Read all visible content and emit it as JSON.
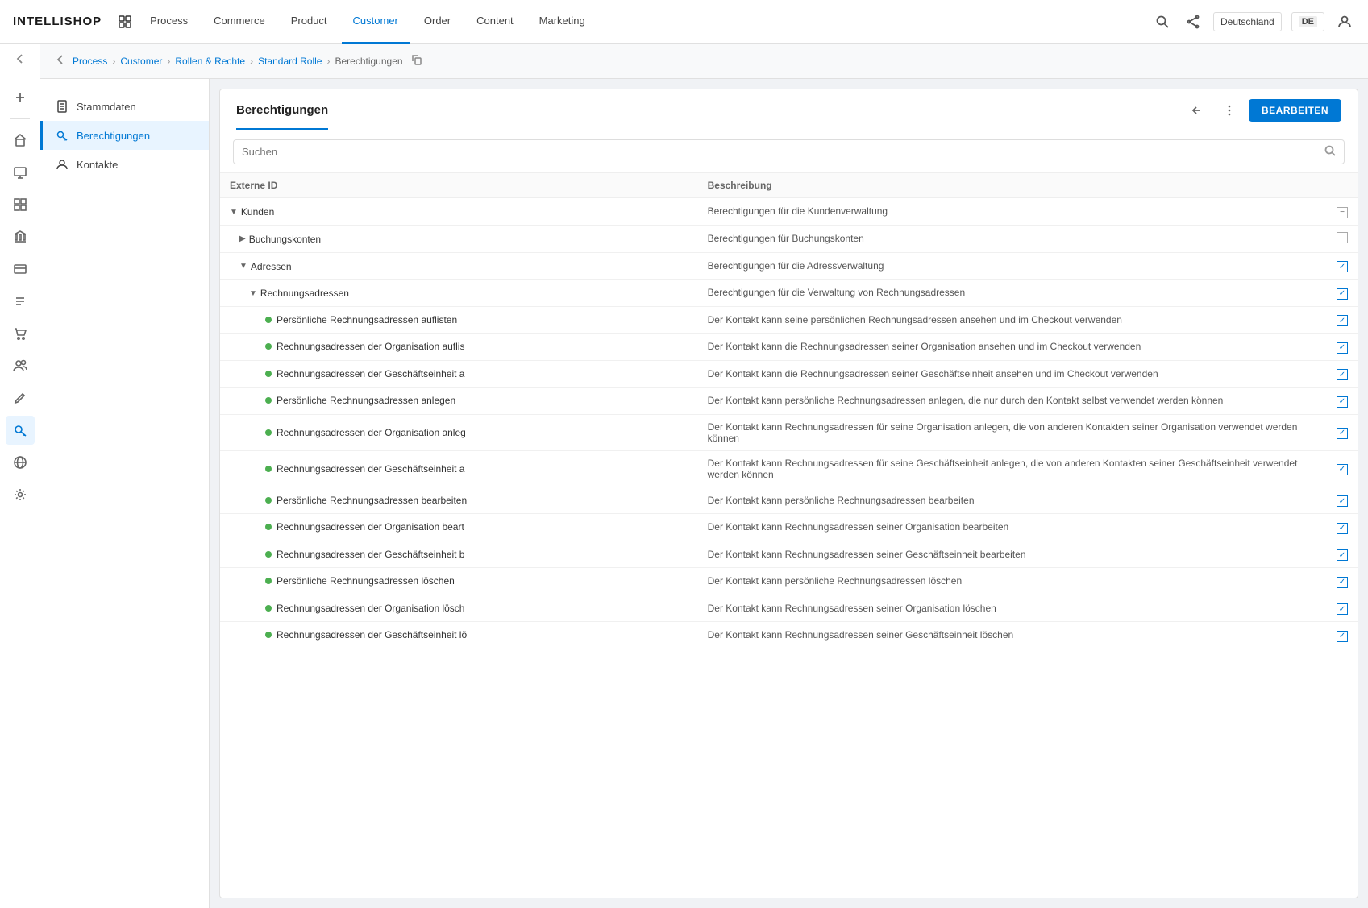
{
  "logo": "INTELLISHOP",
  "nav": {
    "items": [
      {
        "label": "Process",
        "active": false
      },
      {
        "label": "Commerce",
        "active": false
      },
      {
        "label": "Product",
        "active": false
      },
      {
        "label": "Customer",
        "active": true
      },
      {
        "label": "Order",
        "active": false
      },
      {
        "label": "Content",
        "active": false
      },
      {
        "label": "Marketing",
        "active": false
      }
    ],
    "language": "Deutschland",
    "langCode": "DE"
  },
  "breadcrumb": {
    "items": [
      "Process",
      "Customer",
      "Rollen & Rechte",
      "Standard Rolle"
    ],
    "current": "Berechtigungen"
  },
  "sidebarNav": {
    "items": [
      {
        "label": "Stammdaten",
        "icon": "document"
      },
      {
        "label": "Berechtigungen",
        "icon": "key",
        "active": true
      },
      {
        "label": "Kontakte",
        "icon": "contacts"
      }
    ]
  },
  "panel": {
    "title": "Berechtigungen",
    "editLabel": "BEARBEITEN",
    "search": {
      "placeholder": "Suchen"
    },
    "table": {
      "columns": [
        "Externe ID",
        "Beschreibung"
      ],
      "rows": [
        {
          "indent": 0,
          "expand": "down",
          "dot": false,
          "label": "Kunden",
          "desc": "Berechtigungen für die Kundenverwaltung",
          "check": "minus"
        },
        {
          "indent": 1,
          "expand": "right",
          "dot": false,
          "label": "Buchungskonten",
          "desc": "Berechtigungen für Buchungskonten",
          "check": "empty"
        },
        {
          "indent": 1,
          "expand": "down",
          "dot": false,
          "label": "Adressen",
          "desc": "Berechtigungen für die Adressverwaltung",
          "check": "checked"
        },
        {
          "indent": 2,
          "expand": "down",
          "dot": false,
          "label": "Rechnungsadressen",
          "desc": "Berechtigungen für die Verwaltung von Rechnungsadressen",
          "check": "checked"
        },
        {
          "indent": 3,
          "expand": false,
          "dot": true,
          "label": "Persönliche Rechnungsadressen auflisten",
          "desc": "Der Kontakt kann seine persönlichen Rechnungsadressen ansehen und im Checkout verwenden",
          "check": "checked"
        },
        {
          "indent": 3,
          "expand": false,
          "dot": true,
          "label": "Rechnungsadressen der Organisation auflis",
          "desc": "Der Kontakt kann die Rechnungsadressen seiner Organisation ansehen und im Checkout verwenden",
          "check": "checked"
        },
        {
          "indent": 3,
          "expand": false,
          "dot": true,
          "label": "Rechnungsadressen der Geschäftseinheit a",
          "desc": "Der Kontakt kann die Rechnungsadressen seiner Geschäftseinheit ansehen und im Checkout verwenden",
          "check": "checked"
        },
        {
          "indent": 3,
          "expand": false,
          "dot": true,
          "label": "Persönliche Rechnungsadressen anlegen",
          "desc": "Der Kontakt kann persönliche Rechnungsadressen anlegen, die nur durch den Kontakt selbst verwendet werden können",
          "check": "checked"
        },
        {
          "indent": 3,
          "expand": false,
          "dot": true,
          "label": "Rechnungsadressen der Organisation anleg",
          "desc": "Der Kontakt kann Rechnungsadressen für seine Organisation anlegen, die von anderen Kontakten seiner Organisation verwendet werden können",
          "check": "checked"
        },
        {
          "indent": 3,
          "expand": false,
          "dot": true,
          "label": "Rechnungsadressen der Geschäftseinheit a",
          "desc": "Der Kontakt kann Rechnungsadressen für seine Geschäftseinheit anlegen, die von anderen Kontakten seiner Geschäftseinheit verwendet werden können",
          "check": "checked"
        },
        {
          "indent": 3,
          "expand": false,
          "dot": true,
          "label": "Persönliche Rechnungsadressen bearbeiten",
          "desc": "Der Kontakt kann persönliche Rechnungsadressen bearbeiten",
          "check": "checked"
        },
        {
          "indent": 3,
          "expand": false,
          "dot": true,
          "label": "Rechnungsadressen der Organisation beart",
          "desc": "Der Kontakt kann Rechnungsadressen seiner Organisation bearbeiten",
          "check": "checked"
        },
        {
          "indent": 3,
          "expand": false,
          "dot": true,
          "label": "Rechnungsadressen der Geschäftseinheit b",
          "desc": "Der Kontakt kann Rechnungsadressen seiner Geschäftseinheit bearbeiten",
          "check": "checked"
        },
        {
          "indent": 3,
          "expand": false,
          "dot": true,
          "label": "Persönliche Rechnungsadressen löschen",
          "desc": "Der Kontakt kann persönliche Rechnungsadressen löschen",
          "check": "checked"
        },
        {
          "indent": 3,
          "expand": false,
          "dot": true,
          "label": "Rechnungsadressen der Organisation lösch",
          "desc": "Der Kontakt kann Rechnungsadressen seiner Organisation löschen",
          "check": "checked"
        },
        {
          "indent": 3,
          "expand": false,
          "dot": true,
          "label": "Rechnungsadressen der Geschäftseinheit lö",
          "desc": "Der Kontakt kann Rechnungsadressen seiner Geschäftseinheit löschen",
          "check": "checked"
        }
      ]
    }
  }
}
